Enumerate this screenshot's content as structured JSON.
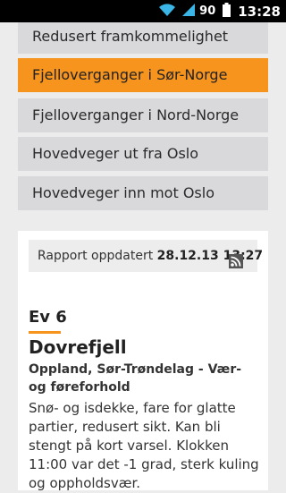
{
  "status_bar": {
    "battery": "90",
    "time": "13:28"
  },
  "menu": {
    "items": [
      {
        "label": "Redusert framkommelighet"
      },
      {
        "label": "Fjelloverganger i Sør-Norge"
      },
      {
        "label": "Fjelloverganger i Nord-Norge"
      },
      {
        "label": "Hovedveger ut fra Oslo"
      },
      {
        "label": "Hovedveger inn mot Oslo"
      }
    ],
    "active_color": "#f7941d"
  },
  "report": {
    "label": "Rapport oppdatert",
    "timestamp": "28.12.13 13:27",
    "icon": "rss-icon"
  },
  "entry": {
    "road_number": "Ev 6",
    "place": "Dovrefjell",
    "region": "Oppland, Sør-Trøndelag - Vær- og føreforhold",
    "description": "Snø- og isdekke, fare for glatte partier, redusert sikt. Kan bli stengt på kort varsel. Klokken 11:00 var det -1 grad, sterk kuling og oppholdsvær."
  }
}
